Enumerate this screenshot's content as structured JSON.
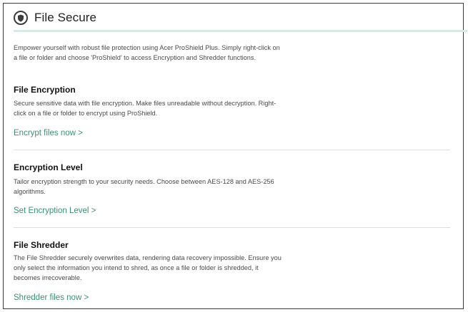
{
  "header": {
    "title": "File Secure",
    "icon": "shield-icon"
  },
  "intro": "Empower yourself with robust file protection using Acer ProShield Plus. Simply right-click on a file or folder and choose 'ProShield' to access Encryption and Shredder functions.",
  "sections": [
    {
      "title": "File Encryption",
      "text": "Secure sensitive data with file encryption. Make files unreadable without decryption. Right-click on a file or folder to encrypt using ProShield.",
      "link": "Encrypt files now >"
    },
    {
      "title": "Encryption Level",
      "text": "Tailor encryption strength to your security needs. Choose between AES-128 and AES-256 algorithms.",
      "link": "Set Encryption Level >"
    },
    {
      "title": "File Shredder",
      "text": "The File Shredder securely overwrites data, rendering data recovery impossible. Ensure you only select the information you intend to shred, as once a file or folder is shredded, it becomes irrecoverable.",
      "link": "Shredder files now >"
    }
  ],
  "colors": {
    "accent": "#3e8f71",
    "header_rule": "#d9e9e4"
  }
}
